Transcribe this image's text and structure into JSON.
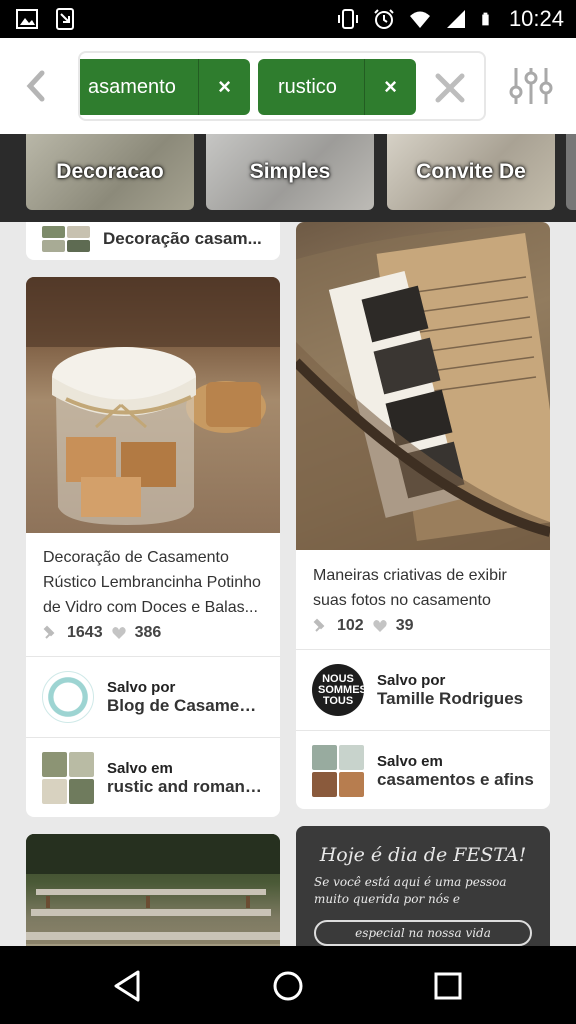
{
  "status_bar": {
    "time": "10:24",
    "icons": [
      "image-icon",
      "download-icon",
      "vibrate-icon",
      "alarm-icon",
      "wifi-icon",
      "signal-icon",
      "battery-icon"
    ]
  },
  "search": {
    "chips": [
      {
        "label": "asamento",
        "remove_label": "×"
      },
      {
        "label": "rustico",
        "remove_label": "×"
      }
    ],
    "icons": [
      "back-arrow-icon",
      "clear-icon",
      "filter-sliders-icon"
    ]
  },
  "guides": [
    "Decoracao",
    "Simples",
    "Convite De"
  ],
  "feed": {
    "partial_card": {
      "label": "Decoração casam..."
    },
    "pin1": {
      "description": "Decoração de Casamento Rústico Lembrancinha Potinho de Vidro com Doces e Balas...",
      "repins": "1643",
      "likes": "386",
      "saved_by_label": "Salvo por",
      "saved_by_name": "Blog de Casament...",
      "saved_in_label": "Salvo em",
      "saved_in_board": "rustic and romanti..."
    },
    "pin2": {
      "description": "Maneiras criativas de exibir suas fotos no casamento",
      "repins": "102",
      "likes": "39",
      "saved_by_label": "Salvo por",
      "saved_by_name": "Tamille Rodrigues",
      "avatar_text": "NOUS SOMMES TOUS",
      "saved_in_label": "Salvo em",
      "saved_in_board": "casamentos e afins"
    },
    "pin4": {
      "image_text_title": "Hoje é dia de FESTA!",
      "image_text_body": "Se você está aqui é uma pessoa muito querida por nós e",
      "image_text_banner": "especial na nossa vida"
    }
  },
  "colors": {
    "chip_green": "#2f7d2e",
    "accent_divider": "#e6e6e6",
    "card_bg": "#ffffff"
  }
}
